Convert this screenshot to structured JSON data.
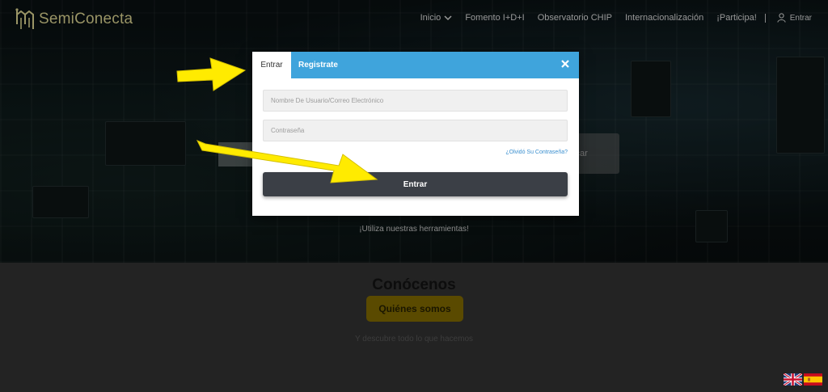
{
  "brand": {
    "name": "SemiConecta",
    "color": "#9a9566"
  },
  "nav": {
    "items": [
      {
        "label": "Inicio",
        "has_dropdown": true
      },
      {
        "label": "Fomento I+D+I",
        "has_dropdown": false
      },
      {
        "label": "Observatorio CHIP",
        "has_dropdown": false
      },
      {
        "label": "Internacionalización",
        "has_dropdown": false
      },
      {
        "label": "¡Participa!",
        "has_dropdown": false
      }
    ],
    "login_label": "Entrar",
    "login_icon": "user-icon"
  },
  "hero": {
    "search_button_text": "scar",
    "tools_text": "¡Utiliza nuestras herramientas!"
  },
  "about": {
    "title": "Conócenos",
    "button_label": "Quiénes somos",
    "subtitle": "Y descubre todo lo que hacemos"
  },
  "languages": [
    "en-flag-icon",
    "es-flag-icon"
  ],
  "modal": {
    "tabs": [
      {
        "label": "Entrar",
        "active": true
      },
      {
        "label": "Registrate",
        "active": false
      }
    ],
    "close_icon": "close-icon",
    "username_placeholder": "Nombre De Usuario/Correo Electrónico",
    "password_placeholder": "Contraseña",
    "forgot_link": "¿Olvidó Su Contraseña?",
    "submit_label": "Entrar",
    "accent_color": "#3fa4dc",
    "button_color": "#3b3f46"
  },
  "annotations": {
    "arrow_color": "#ffeb00",
    "count": 2
  }
}
